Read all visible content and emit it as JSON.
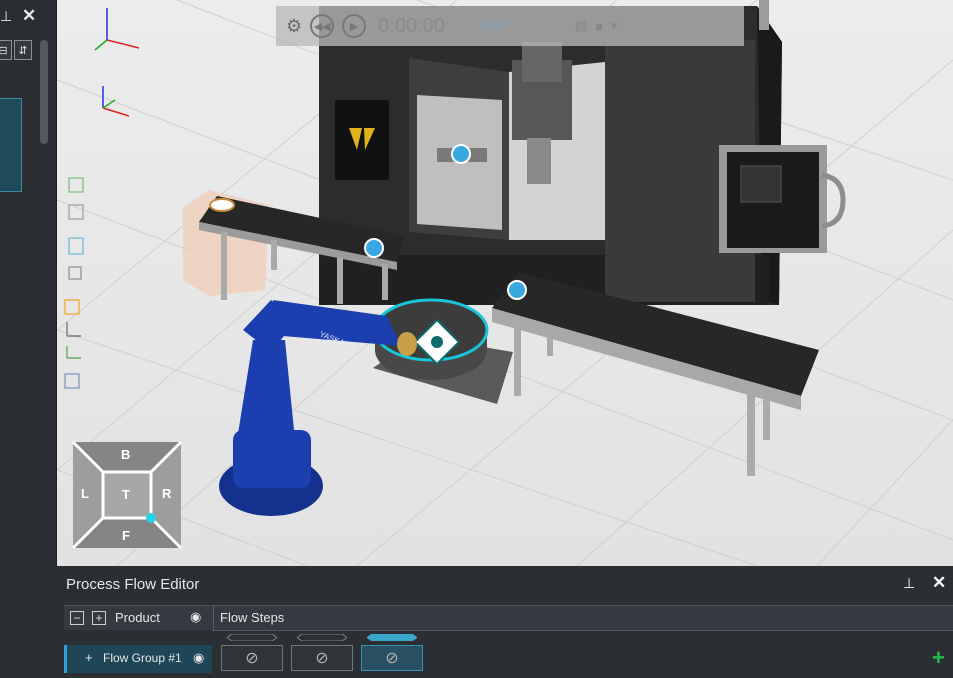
{
  "left_panel": {
    "pin_icon": "pin-icon",
    "close_symbol": "✕",
    "btn_a_symbol": "⊟",
    "btn_b_symbol": "⇵"
  },
  "viewport": {
    "toolbar": {
      "time": "0:00:00",
      "speed": "x 4.0",
      "icons": [
        "gear-icon",
        "rewind-icon",
        "play-icon",
        "pdf-icon",
        "video-icon",
        "settings-dropdown-icon"
      ]
    },
    "nav_cube": {
      "top": "B",
      "left": "L",
      "center": "T",
      "right": "R",
      "bottom": "F"
    },
    "view_tools": [
      "fit-selection-icon",
      "fit-all-icon",
      "grid-view-icon",
      "box-view-icon",
      "orientation-icon",
      "axes-icon",
      "measure-icon",
      "render-mode-icon"
    ],
    "robot_brand": "YASKAWA",
    "colors": {
      "robot": "#1c3fb0",
      "selection_ring": "#19c5d9",
      "interaction_dot": "#3aa8e0"
    }
  },
  "process_flow_editor": {
    "title": "Process Flow Editor",
    "columns": {
      "product": "Product",
      "flow_steps": "Flow Steps"
    },
    "header_buttons": {
      "collapse": "−",
      "expand": "+"
    },
    "group": {
      "expand": "+",
      "label": "Flow Group #1"
    },
    "steps": [
      {
        "symbol": "⃠",
        "selected": false
      },
      {
        "symbol": "⃠",
        "selected": false
      },
      {
        "symbol": "⃠",
        "selected": true
      }
    ],
    "add_symbol": "+"
  }
}
